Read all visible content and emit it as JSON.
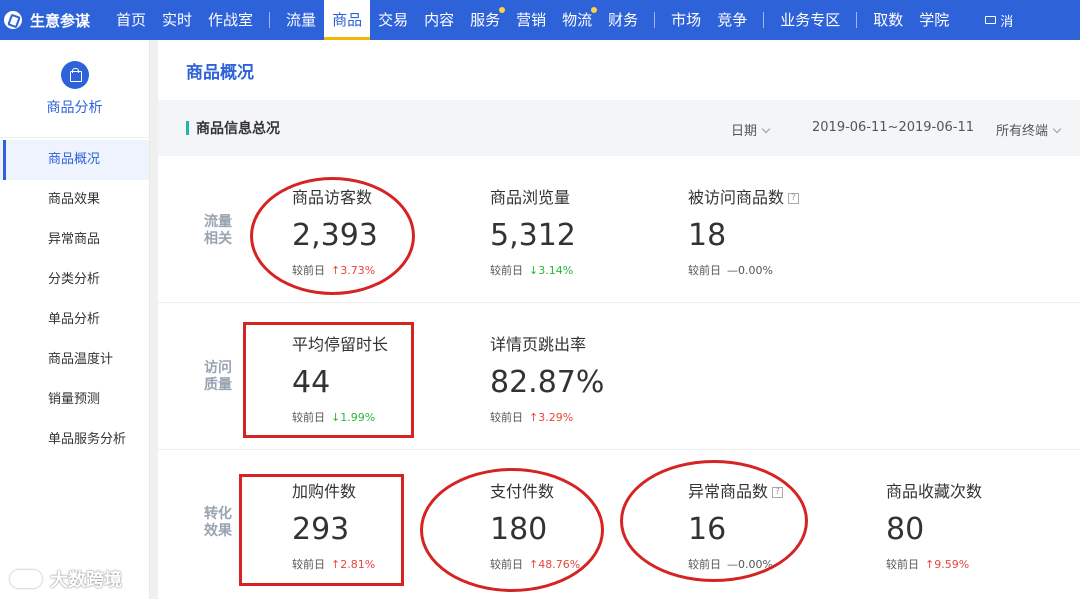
{
  "app": {
    "brand": "生意参谋"
  },
  "topnav": {
    "items": [
      "首页",
      "实时",
      "作战室",
      "流量",
      "商品",
      "交易",
      "内容",
      "服务",
      "营销",
      "物流",
      "财务",
      "市场",
      "竞争",
      "业务专区",
      "取数",
      "学院"
    ],
    "active": "商品",
    "mail_trunc": "消"
  },
  "sidebar": {
    "title": "商品分析",
    "items": [
      "商品概况",
      "商品效果",
      "异常商品",
      "分类分析",
      "单品分析",
      "商品温度计",
      "销量预测",
      "单品服务分析"
    ],
    "active": "商品概况"
  },
  "main": {
    "page_title": "商品概况",
    "section_title": "商品信息总况",
    "filters": {
      "date_label": "日期",
      "date_range": "2019-06-11~2019-06-11",
      "terminal": "所有终端"
    }
  },
  "compare_label": "较前日",
  "groups": [
    {
      "label": "流量相关",
      "metrics": [
        {
          "title": "商品访客数",
          "value": "2,393",
          "trend": "up",
          "change": "3.73%"
        },
        {
          "title": "商品浏览量",
          "value": "5,312",
          "trend": "down",
          "change": "3.14%"
        },
        {
          "title": "被访问商品数",
          "value": "18",
          "trend": "flat",
          "change": "0.00%",
          "help": "?"
        }
      ]
    },
    {
      "label": "访问质量",
      "metrics": [
        {
          "title": "平均停留时长",
          "value": "44",
          "trend": "down",
          "change": "1.99%"
        },
        {
          "title": "详情页跳出率",
          "value": "82.87%",
          "trend": "up",
          "change": "3.29%"
        }
      ]
    },
    {
      "label": "转化效果",
      "metrics": [
        {
          "title": "加购件数",
          "value": "293",
          "trend": "up",
          "change": "2.81%"
        },
        {
          "title": "支付件数",
          "value": "180",
          "trend": "up",
          "change": "48.76%"
        },
        {
          "title": "异常商品数",
          "value": "16",
          "trend": "flat",
          "change": "0.00%",
          "help": "?"
        },
        {
          "title": "商品收藏次数",
          "value": "80",
          "trend": "up",
          "change": "9.59%"
        }
      ]
    }
  ],
  "trend_glyphs": {
    "up": "↑",
    "down": "↓",
    "flat": "—"
  },
  "colors": {
    "primary": "#2e62d9",
    "up": "#e8463a",
    "down": "#2bb53a",
    "highlight": "#d62323"
  },
  "watermark": "大数跨境"
}
